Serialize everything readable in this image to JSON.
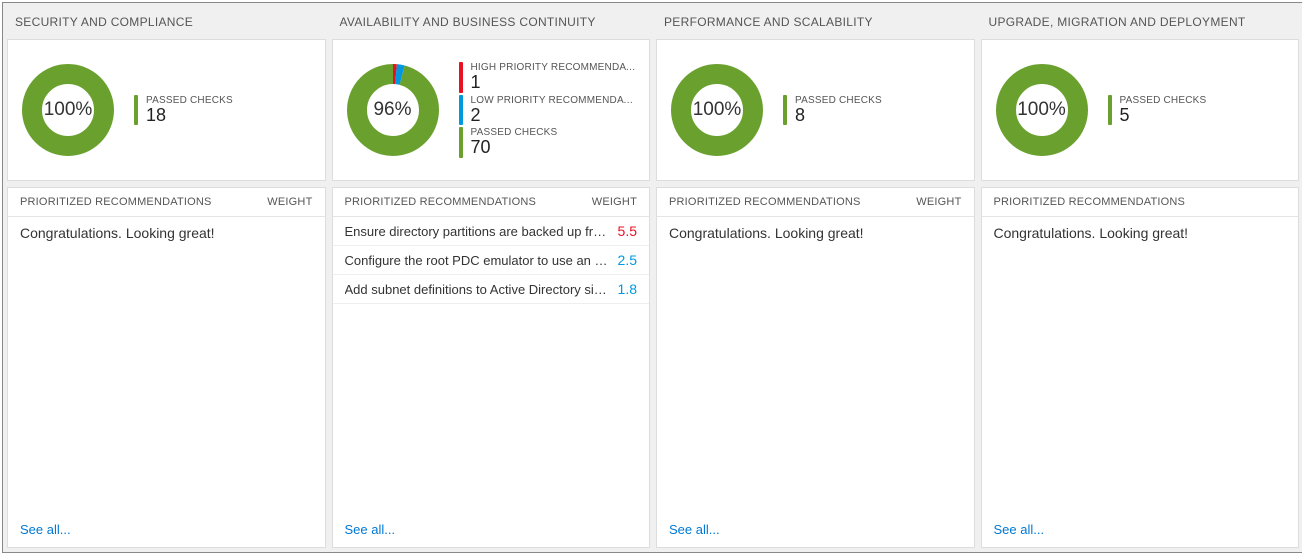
{
  "colors": {
    "green": "#6aa12e",
    "red": "#e81123",
    "blue": "#0099e0"
  },
  "labels": {
    "prioritized": "PRIORITIZED RECOMMENDATIONS",
    "weight": "WEIGHT",
    "see_all": "See all...",
    "congrats": "Congratulations. Looking great!",
    "passed": "PASSED CHECKS",
    "high": "HIGH PRIORITY RECOMMENDATI…",
    "low": "LOW PRIORITY RECOMMENDATIO…"
  },
  "columns": [
    {
      "title": "SECURITY AND COMPLIANCE",
      "percent": "100%",
      "pct_num": 100,
      "legend": [
        {
          "label_key": "passed",
          "value": "18",
          "color_key": "green"
        }
      ],
      "recs": [],
      "show_weight": true
    },
    {
      "title": "AVAILABILITY AND BUSINESS CONTINUITY",
      "percent": "96%",
      "pct_num": 96,
      "legend": [
        {
          "label_key": "high",
          "value": "1",
          "color_key": "red"
        },
        {
          "label_key": "low",
          "value": "2",
          "color_key": "blue"
        },
        {
          "label_key": "passed",
          "value": "70",
          "color_key": "green"
        }
      ],
      "recs": [
        {
          "text": "Ensure directory partitions are backed up frequently.",
          "weight": "5.5",
          "color_key": "red"
        },
        {
          "text": "Configure the root PDC emulator to use an authorita…",
          "weight": "2.5",
          "color_key": "blue"
        },
        {
          "text": "Add subnet definitions to Active Directory sites.",
          "weight": "1.8",
          "color_key": "blue"
        }
      ],
      "show_weight": true
    },
    {
      "title": "PERFORMANCE AND SCALABILITY",
      "percent": "100%",
      "pct_num": 100,
      "legend": [
        {
          "label_key": "passed",
          "value": "8",
          "color_key": "green"
        }
      ],
      "recs": [],
      "show_weight": true
    },
    {
      "title": "UPGRADE, MIGRATION AND DEPLOYMENT",
      "percent": "100%",
      "pct_num": 100,
      "legend": [
        {
          "label_key": "passed",
          "value": "5",
          "color_key": "green"
        }
      ],
      "recs": [],
      "show_weight": false
    }
  ],
  "chart_data": [
    {
      "type": "pie",
      "title": "SECURITY AND COMPLIANCE",
      "series": [
        {
          "name": "Passed",
          "value": 18
        }
      ],
      "percent": 100
    },
    {
      "type": "pie",
      "title": "AVAILABILITY AND BUSINESS CONTINUITY",
      "series": [
        {
          "name": "High priority",
          "value": 1
        },
        {
          "name": "Low priority",
          "value": 2
        },
        {
          "name": "Passed",
          "value": 70
        }
      ],
      "percent": 96
    },
    {
      "type": "pie",
      "title": "PERFORMANCE AND SCALABILITY",
      "series": [
        {
          "name": "Passed",
          "value": 8
        }
      ],
      "percent": 100
    },
    {
      "type": "pie",
      "title": "UPGRADE, MIGRATION AND DEPLOYMENT",
      "series": [
        {
          "name": "Passed",
          "value": 5
        }
      ],
      "percent": 100
    }
  ]
}
